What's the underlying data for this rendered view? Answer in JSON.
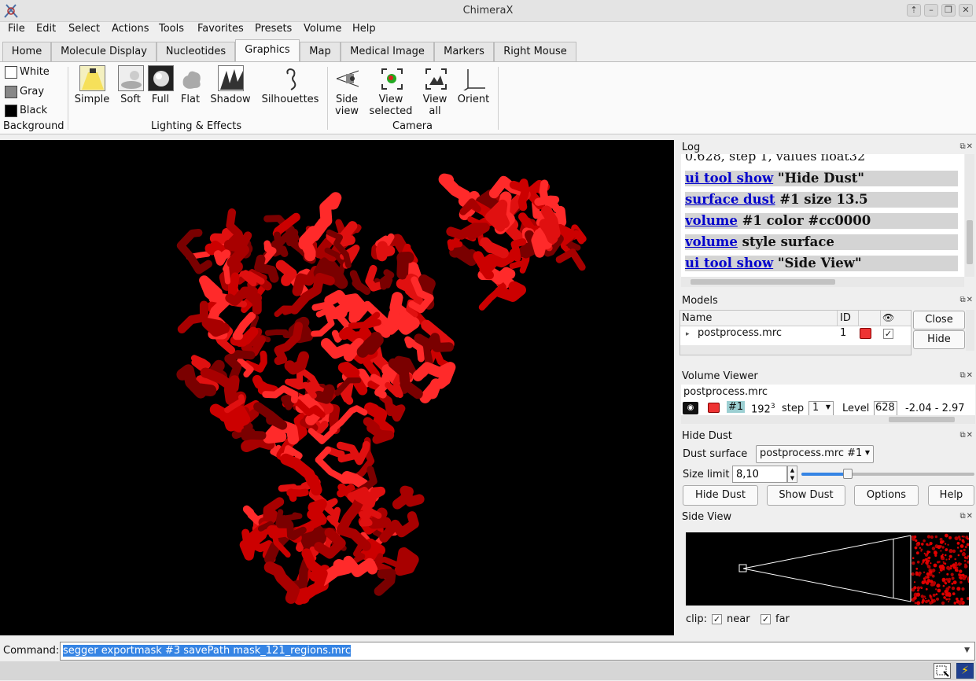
{
  "window": {
    "title": "ChimeraX"
  },
  "menubar": [
    "File",
    "Edit",
    "Select",
    "Actions",
    "Tools",
    "Favorites",
    "Presets",
    "Volume",
    "Help"
  ],
  "tabs": [
    "Home",
    "Molecule Display",
    "Nucleotides",
    "Graphics",
    "Map",
    "Medical Image",
    "Markers",
    "Right Mouse"
  ],
  "active_tab": "Graphics",
  "ribbon": {
    "background": {
      "white": "White",
      "gray": "Gray",
      "black": "Black",
      "group": "Background"
    },
    "lighting": {
      "simple": "Simple",
      "soft": "Soft",
      "full": "Full",
      "flat": "Flat",
      "shadow": "Shadow",
      "silhouettes": "Silhouettes",
      "group": "Lighting & Effects"
    },
    "camera": {
      "side_view_1": "Side",
      "side_view_2": "view",
      "view_selected_1": "View",
      "view_selected_2": "selected",
      "view_all_1": "View",
      "view_all_2": "all",
      "orient": "Orient",
      "group": "Camera"
    }
  },
  "log": {
    "title": "Log",
    "partial_line": "0.628, step 1, values float32",
    "lines": [
      {
        "cmd": "ui tool show",
        "rest": " \"Hide Dust\""
      },
      {
        "cmd": "surface dust",
        "rest": " #1 size 13.5"
      },
      {
        "cmd": "volume",
        "rest": " #1 color #cc0000"
      },
      {
        "cmd": "volume",
        "rest": " style surface"
      },
      {
        "cmd": "ui tool show",
        "rest": " \"Side View\""
      }
    ]
  },
  "models": {
    "title": "Models",
    "col_name": "Name",
    "col_id": "ID",
    "row_name": "postprocess.mrc",
    "row_id": "1",
    "close_label": "Close",
    "hide_label": "Hide"
  },
  "volume_viewer": {
    "title": "Volume Viewer",
    "file": "postprocess.mrc",
    "id": "#1",
    "size": "192",
    "size_sup": "3",
    "step_label": "step",
    "step_value": "1",
    "level_label": "Level",
    "level_value": "628",
    "range": "-2.04 - 2.97"
  },
  "hide_dust": {
    "title": "Hide Dust",
    "surface_label": "Dust surface",
    "surface_value": "postprocess.mrc #1",
    "size_label": "Size limit",
    "size_value": "8,10",
    "slider_fraction": 0.27,
    "buttons": {
      "hide": "Hide Dust",
      "show": "Show Dust",
      "options": "Options",
      "help": "Help"
    }
  },
  "side_view": {
    "title": "Side View",
    "clip_label": "clip:",
    "near": "near",
    "far": "far"
  },
  "command": {
    "label": "Command:",
    "value": "segger exportmask #3 savePath mask_121_regions.mrc"
  },
  "colors": {
    "map": "#cc0000",
    "log_highlight": "#d4d4d4",
    "link": "#0000cc",
    "selection": "#3584e4"
  }
}
